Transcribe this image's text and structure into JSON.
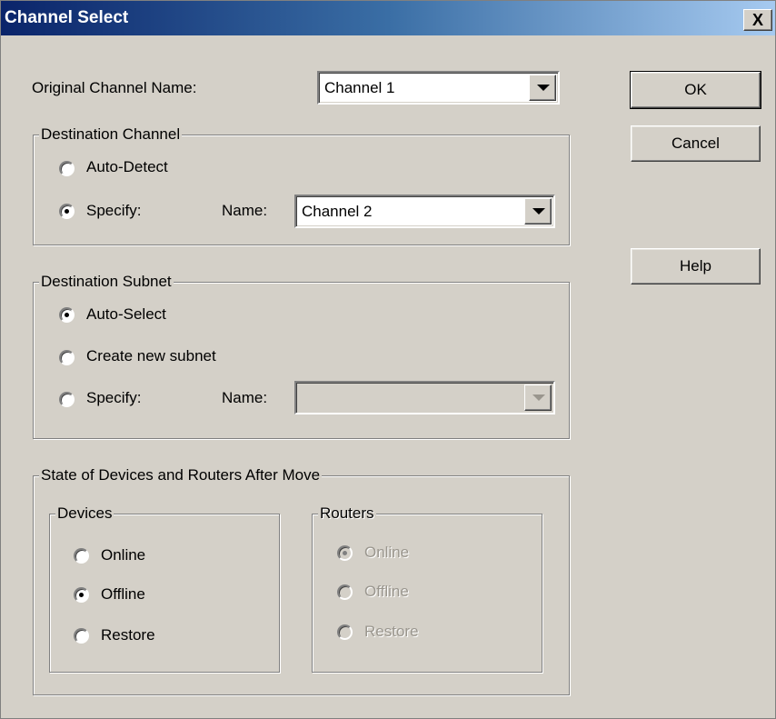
{
  "window": {
    "title": "Channel Select",
    "close_label": "X"
  },
  "original_channel": {
    "label": "Original Channel Name:",
    "value": "Channel 1"
  },
  "destination_channel": {
    "legend": "Destination Channel",
    "auto_label": "Auto-Detect",
    "specify_label": "Specify:",
    "name_label": "Name:",
    "name_value": "Channel 2",
    "selected": "specify"
  },
  "destination_subnet": {
    "legend": "Destination Subnet",
    "auto_label": "Auto-Select",
    "create_label": "Create new subnet",
    "specify_label": "Specify:",
    "name_label": "Name:",
    "name_value": "",
    "selected": "auto"
  },
  "state": {
    "legend": "State of Devices and Routers After Move",
    "devices": {
      "legend": "Devices",
      "online": "Online",
      "offline": "Offline",
      "restore": "Restore",
      "selected": "offline"
    },
    "routers": {
      "legend": "Routers",
      "online": "Online",
      "offline": "Offline",
      "restore": "Restore",
      "selected": "online",
      "enabled": false
    }
  },
  "buttons": {
    "ok": "OK",
    "cancel": "Cancel",
    "help": "Help"
  },
  "colors": {
    "title_start": "#0a246a",
    "title_end": "#a6caf0",
    "face": "#d4d0c8"
  }
}
